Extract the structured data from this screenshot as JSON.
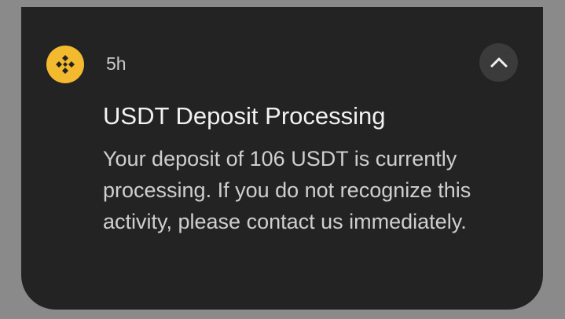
{
  "notification": {
    "app_icon": "binance-logo-icon",
    "brand_color": "#f3ba2f",
    "time": "5h",
    "collapse_icon": "chevron-up-icon",
    "title": "USDT Deposit Processing",
    "body_lines": [
      "Your deposit of 106 USDT is currently",
      "processing. If you do not recognize this",
      "activity, please contact us immediately."
    ]
  }
}
